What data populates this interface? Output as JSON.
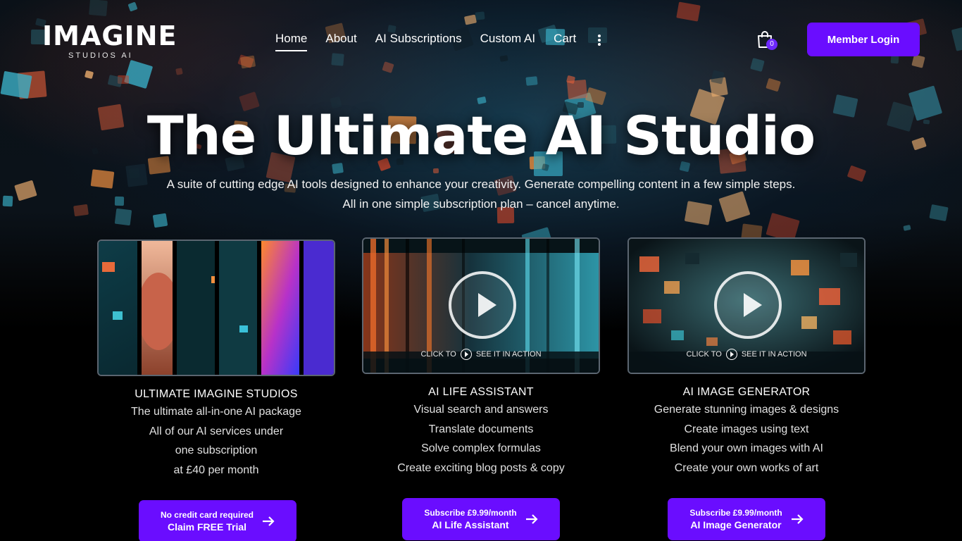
{
  "brand": {
    "name": "IMAGINE",
    "tagline": "STUDIOS AI"
  },
  "nav": {
    "items": [
      {
        "label": "Home",
        "active": true
      },
      {
        "label": "About"
      },
      {
        "label": "AI Subscriptions"
      },
      {
        "label": "Custom AI"
      },
      {
        "label": "Cart"
      }
    ],
    "more_icon": "vertical-dots-icon"
  },
  "cart": {
    "icon": "shopping-bag-icon",
    "count": "0"
  },
  "login": {
    "label": "Member Login"
  },
  "hero": {
    "title": "The Ultimate AI Studio",
    "subtitle": "A suite of cutting edge AI tools designed to enhance your creativity. Generate compelling content in a few simple steps. All in one simple subscription plan – cancel anytime."
  },
  "colors": {
    "accent": "#6a0dff",
    "background": "#000000"
  },
  "cards": [
    {
      "title": "ULTIMATE IMAGINE STUDIOS",
      "lines": [
        "The ultimate all-in-one AI package",
        "All of our AI services under",
        "one subscription",
        "at £40 per month"
      ],
      "cta_small": "No credit card required",
      "cta_big": "Claim FREE Trial"
    },
    {
      "title": "AI LIFE ASSISTANT",
      "lines": [
        "Visual search and answers",
        "Translate documents",
        "Solve complex formulas",
        "Create exciting blog posts & copy"
      ],
      "video_caption_left": "CLICK TO",
      "video_caption_right": "SEE IT IN ACTION",
      "cta_small": "Subscribe £9.99/month",
      "cta_big": "AI Life Assistant"
    },
    {
      "title": "AI IMAGE GENERATOR",
      "lines": [
        "Generate stunning images & designs",
        "Create images using text",
        "Blend your own images with AI",
        "Create your own works of art"
      ],
      "video_caption_left": "CLICK TO",
      "video_caption_right": "SEE IT IN ACTION",
      "cta_small": "Subscribe £9.99/month",
      "cta_big": "AI Image Generator"
    }
  ]
}
